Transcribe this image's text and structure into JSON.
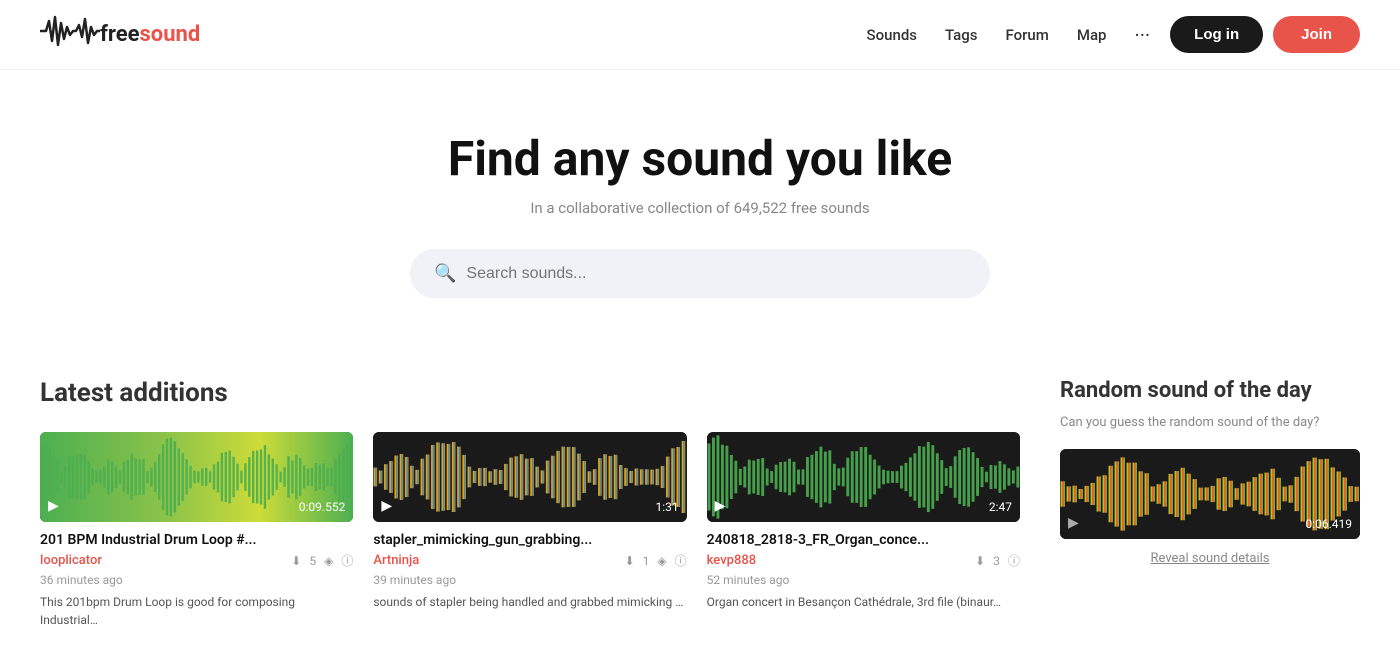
{
  "nav": {
    "logo_free": "free",
    "logo_sound": "sound",
    "links": [
      {
        "label": "Sounds",
        "href": "#"
      },
      {
        "label": "Tags",
        "href": "#"
      },
      {
        "label": "Forum",
        "href": "#"
      },
      {
        "label": "Map",
        "href": "#"
      }
    ],
    "login_label": "Log in",
    "join_label": "Join"
  },
  "hero": {
    "heading": "Find any sound you like",
    "subtext": "In a collaborative collection of 649,522 free sounds",
    "search_placeholder": "Search sounds..."
  },
  "latest": {
    "heading": "Latest additions",
    "sounds": [
      {
        "title": "201 BPM Industrial Drum Loop #...",
        "author": "looplicator",
        "downloads": "5",
        "duration": "0:09.552",
        "time_ago": "36 minutes ago",
        "description": "This 201bpm Drum Loop is good for composing Industrial…",
        "waveform_type": "green_dense"
      },
      {
        "title": "stapler_mimicking_gun_grabbing...",
        "author": "Artninja",
        "downloads": "1",
        "duration": "1:31",
        "time_ago": "39 minutes ago",
        "description": "sounds of stapler being handled and grabbed mimicking …",
        "waveform_type": "orange_blue"
      },
      {
        "title": "240818_2818-3_FR_Organ_conce...",
        "author": "kevp888",
        "downloads": "3",
        "duration": "2:47",
        "time_ago": "52 minutes ago",
        "description": "Organ concert in Besançon Cathédrale, 3rd file (binaur…",
        "waveform_type": "green_solid"
      }
    ]
  },
  "random": {
    "heading": "Random sound of the day",
    "desc": "Can you guess the random sound of the day?",
    "duration": "0:06.419",
    "reveal_label": "Reveal sound details",
    "waveform_type": "multicolor"
  }
}
